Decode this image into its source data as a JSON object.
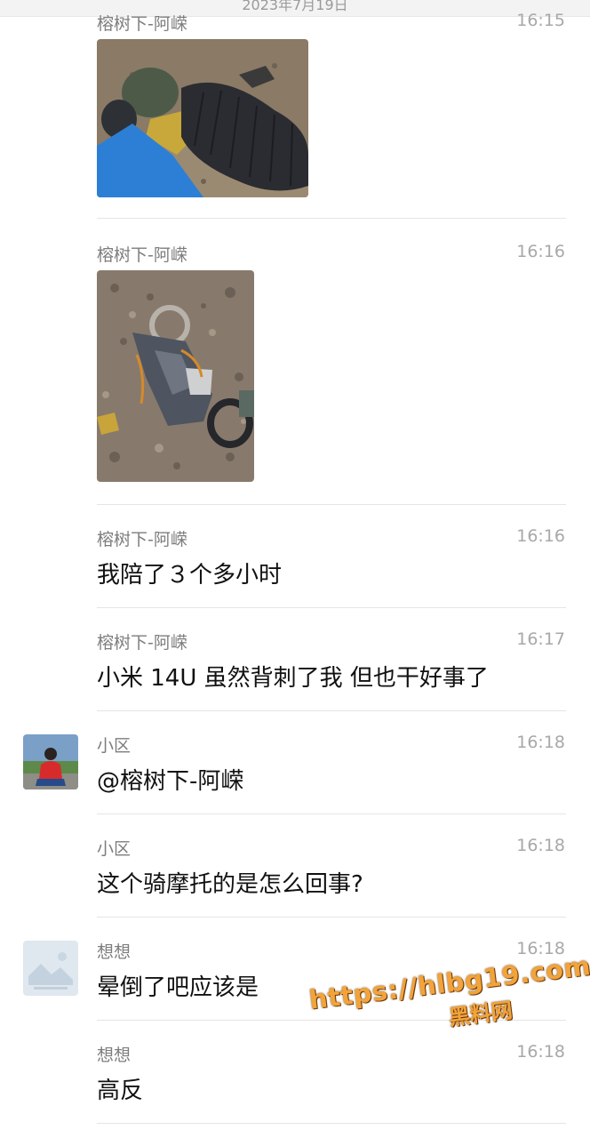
{
  "header": {
    "date": "2023年7月19日"
  },
  "messages": [
    {
      "sender": "榕树下-阿嵘",
      "time": "16:15",
      "type": "image",
      "image": "sleeping-bag-photo"
    },
    {
      "sender": "榕树下-阿嵘",
      "time": "16:16",
      "type": "image",
      "image": "crashed-motorcycle-photo"
    },
    {
      "sender": "榕树下-阿嵘",
      "time": "16:16",
      "text": "我陪了３个多小时"
    },
    {
      "sender": "榕树下-阿嵘",
      "time": "16:17",
      "text": "小米 14U 虽然背刺了我 但也干好事了"
    },
    {
      "sender": "小区",
      "time": "16:18",
      "text": "@榕树下-阿嵘"
    },
    {
      "sender": "小区",
      "time": "16:18",
      "text": "这个骑摩托的是怎么回事?"
    },
    {
      "sender": "想想",
      "time": "16:18",
      "text": "晕倒了吧应该是"
    },
    {
      "sender": "想想",
      "time": "16:18",
      "text": "高反"
    }
  ],
  "watermark": {
    "url": "https://hlbg19.com",
    "name": "黑料网"
  }
}
